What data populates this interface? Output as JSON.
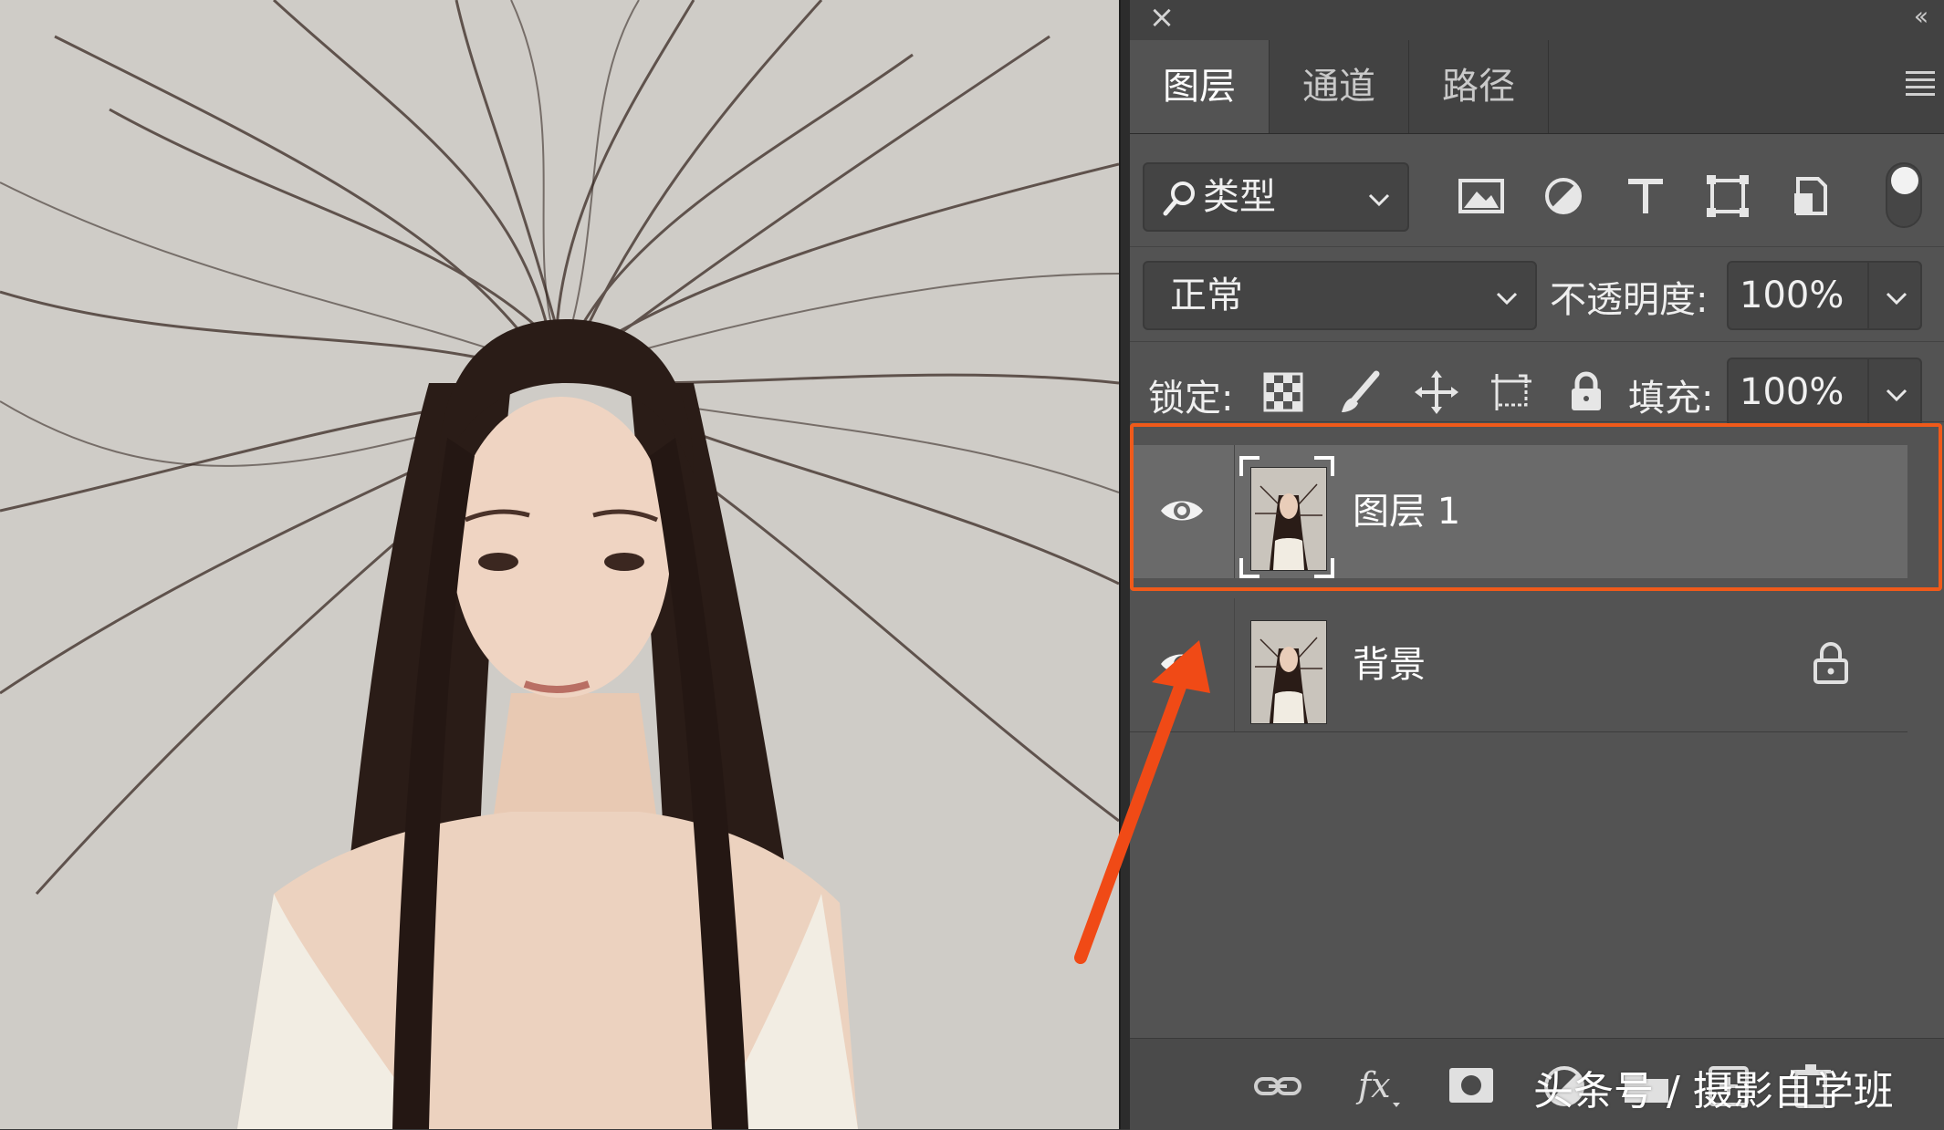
{
  "panel": {
    "tabs": [
      {
        "label": "图层",
        "active": true
      },
      {
        "label": "通道",
        "active": false
      },
      {
        "label": "路径",
        "active": false
      }
    ],
    "filter": {
      "label": "类型",
      "icons": [
        "image-filter-icon",
        "adjustment-filter-icon",
        "type-filter-icon",
        "shape-filter-icon",
        "smart-object-filter-icon"
      ]
    },
    "blend_mode": "正常",
    "opacity": {
      "label": "不透明度:",
      "value": "100%"
    },
    "lock": {
      "label": "锁定:",
      "icons": [
        "lock-transparent-pixels-icon",
        "lock-image-pixels-icon",
        "lock-position-icon",
        "lock-artboard-icon",
        "lock-all-icon"
      ]
    },
    "fill": {
      "label": "填充:",
      "value": "100%"
    },
    "layers": [
      {
        "name": "图层 1",
        "visible": true,
        "selected": true,
        "locked": false
      },
      {
        "name": "背景",
        "visible": true,
        "selected": false,
        "locked": true
      }
    ],
    "bottom_icons": [
      "link-layers-icon",
      "fx-icon",
      "add-mask-icon",
      "adjustment-layer-icon",
      "group-icon",
      "new-layer-icon",
      "delete-layer-icon"
    ]
  },
  "colors": {
    "panel_bg": "#535353",
    "selected_row": "#6a6a6a",
    "highlight": "#f05a1a"
  },
  "watermark": "头条号 / 摄影自学班"
}
